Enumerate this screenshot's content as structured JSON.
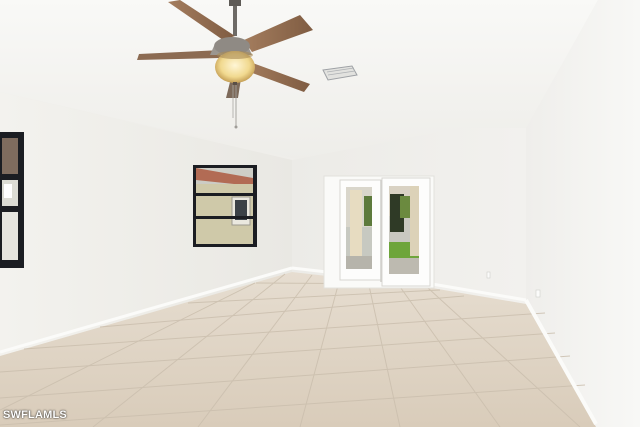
{
  "watermark": {
    "text": "SWFLAMLS"
  },
  "scene": {
    "description_free": true,
    "colors": {
      "ceiling": "#f6f5f2",
      "left_wall": "#f1f0ec",
      "back_wall": "#f4f3f0",
      "right_wall": "#f7f6f3",
      "floor_tile": "#ddd3c4",
      "grout": "#cdbfae",
      "window_frame": "#1b1d22",
      "fan_blade": "#9a7558",
      "fan_light": "#f3dfa8",
      "trim": "#fbfbf9"
    }
  }
}
